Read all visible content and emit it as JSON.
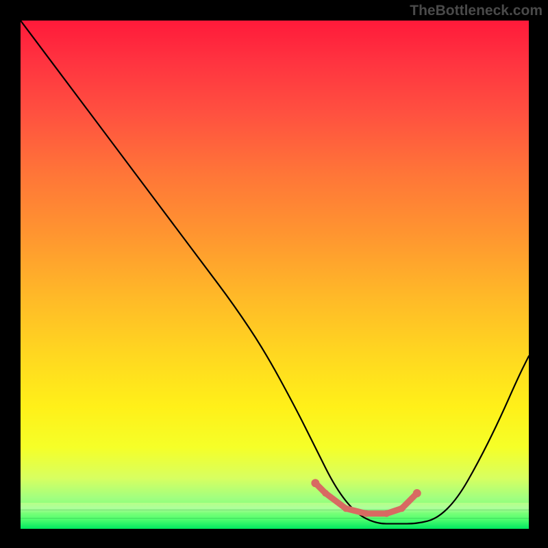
{
  "watermark": "TheBottleneck.com",
  "chart_data": {
    "type": "line",
    "title": "",
    "xlabel": "",
    "ylabel": "",
    "xlim": [
      0,
      100
    ],
    "ylim": [
      0,
      100
    ],
    "series": [
      {
        "name": "bottleneck-curve",
        "x": [
          0,
          6,
          12,
          18,
          24,
          30,
          36,
          42,
          48,
          54,
          58,
          62,
          66,
          70,
          74,
          78,
          82,
          86,
          90,
          94,
          98,
          100
        ],
        "values": [
          100,
          92,
          84,
          76,
          68,
          60,
          52,
          44,
          35,
          24,
          16,
          8,
          3,
          1,
          1,
          1,
          2,
          6,
          13,
          21,
          30,
          34
        ]
      }
    ],
    "markers": {
      "name": "optimal-range",
      "color": "#d86a62",
      "points_x": [
        58,
        60,
        64,
        68,
        72,
        75,
        78
      ],
      "points_y": [
        9,
        7,
        4,
        3,
        3,
        4,
        7
      ]
    },
    "background_gradient": {
      "top": "#ff1a3a",
      "mid": "#ffe020",
      "bottom": "#00e860"
    }
  }
}
